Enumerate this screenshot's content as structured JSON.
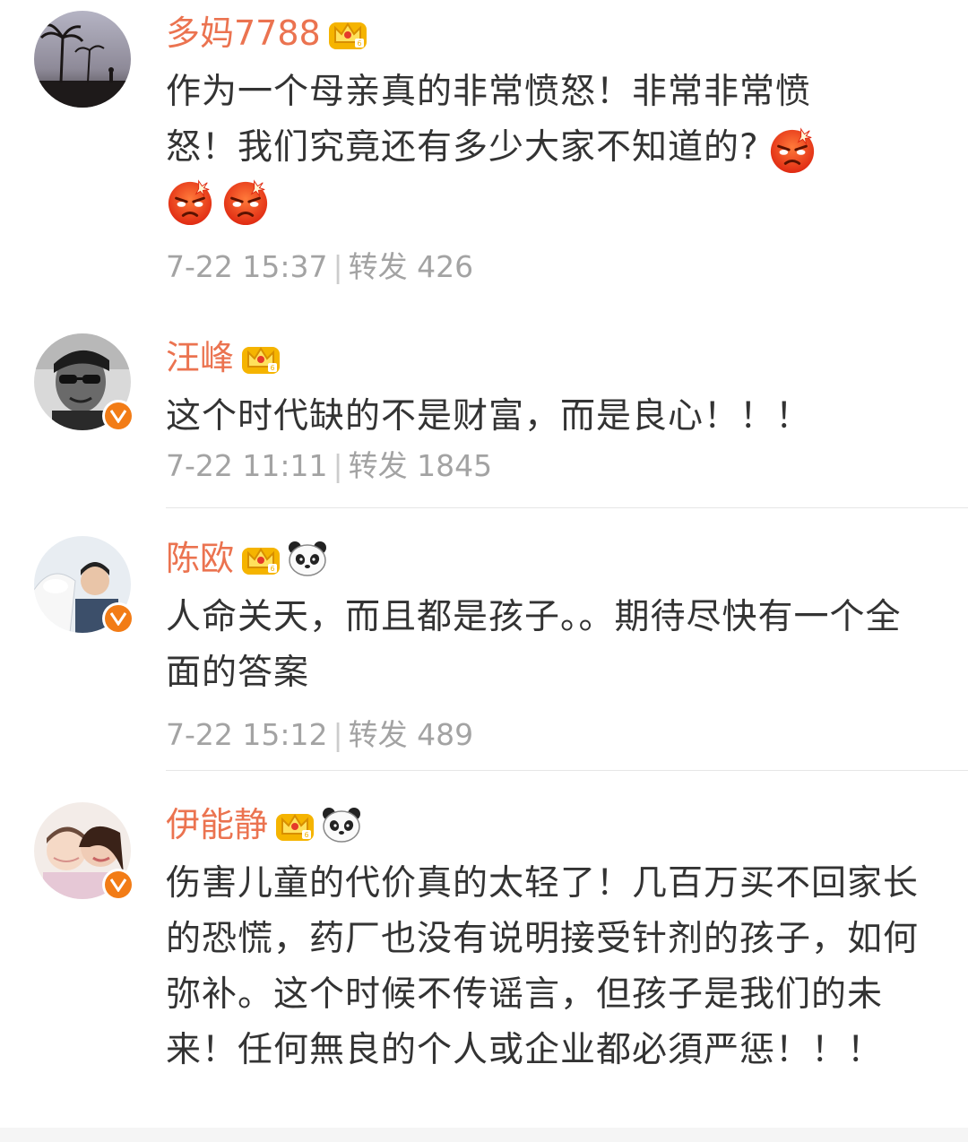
{
  "comments": [
    {
      "name": "多妈7788",
      "text_line1": "作为一个母亲真的非常愤怒！非常非常愤",
      "text_line2": "怒！我们究竟还有多少大家不知道的?",
      "time": "7-22 15:37",
      "separator": "|",
      "repost_label": "转发",
      "repost_count": "426",
      "badges": [
        "crown-icon"
      ],
      "emojis": [
        "angry-emoji",
        "angry-emoji",
        "angry-emoji"
      ]
    },
    {
      "name": "汪峰",
      "text": "这个时代缺的不是财富，而是良心！！！",
      "time": "7-22 11:11",
      "separator": "|",
      "repost_label": "转发",
      "repost_count": "1845",
      "badges": [
        "crown-icon"
      ],
      "verified": true
    },
    {
      "name": "陈欧",
      "text": "人命关天，而且都是孩子。。期待尽快有一个全面的答案",
      "time": "7-22 15:12",
      "separator": "|",
      "repost_label": "转发",
      "repost_count": "489",
      "badges": [
        "crown-icon",
        "panda-icon"
      ],
      "verified": true
    },
    {
      "name": "伊能静",
      "text": "伤害儿童的代价真的太轻了！几百万买不回家长的恐慌，药厂也没有说明接受针剂的孩子，如何弥补。这个时候不传谣言，但孩子是我们的未来！任何無良的个人或企业都必須严惩！！！",
      "badges": [
        "crown-icon",
        "panda-icon"
      ],
      "verified": true
    }
  ],
  "colors": {
    "name": "#eb7350",
    "text": "#333333",
    "meta": "#a3a3a3",
    "verified": "#f27c16",
    "crown": "#f5b400"
  }
}
